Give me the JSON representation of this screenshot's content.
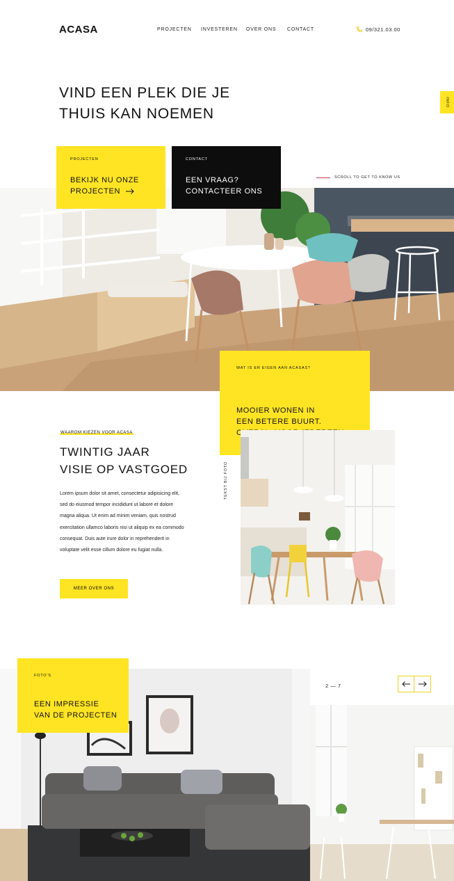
{
  "header": {
    "logo": "ACASA",
    "nav": [
      "PROJECTEN",
      "INVESTEREN",
      "OVER ONS",
      "CONTACT"
    ],
    "phone": "09/321.03.00"
  },
  "info_tab": "INFO",
  "hero": {
    "title_line1": "VIND EEN PLEK DIE JE",
    "title_line2": "THUIS KAN NOEMEN"
  },
  "card_projects": {
    "kicker": "PROJECTEN",
    "line1": "BEKIJK NU ONZE",
    "line2": "PROJECTEN"
  },
  "card_contact": {
    "kicker": "CONTACT",
    "line1": "EEN VRAAG?",
    "line2": "CONTACTEER ONS"
  },
  "scroll_hint": "SCROLL TO GET TO KNOW US",
  "card_what": {
    "kicker": "WAT IS ER EIGEN AAN ACASAS?",
    "line1": "MOOIER WONEN IN",
    "line2": "EEN BETERE BUURT.",
    "line3": "OVERAL, VOOR IEDEREEN."
  },
  "about": {
    "kicker": "WAAROM KIEZEN VOOR ACASA",
    "title_line1": "TWINTIG JAAR",
    "title_line2": "VISIE OP VASTGOED",
    "body": "Lorem ipsum dolor sit amet, consectetur adipisicing elit, sed do eiusmod tempor incididunt ut labore et dolore magna aliqua. Ut enim ad minim veniam, quis nostrud exercitation ullamco laboris nisi ut aliquip ex ea commodo consequat. Duis aute irure dolor in reprehenderit in voluptate velit esse cillum dolore eu fugiat nulla.",
    "button": "MEER OVER ONS",
    "image_caption": "TEKST BIJ FOTO"
  },
  "photos": {
    "kicker": "FOTO'S",
    "line1": "EEN IMPRESSIE",
    "line2": "VAN DE PROJECTEN",
    "counter": "2 — 7"
  },
  "colors": {
    "accent": "#ffe423",
    "dark": "#0d0d0d",
    "scroll_line": "#c23a52"
  }
}
